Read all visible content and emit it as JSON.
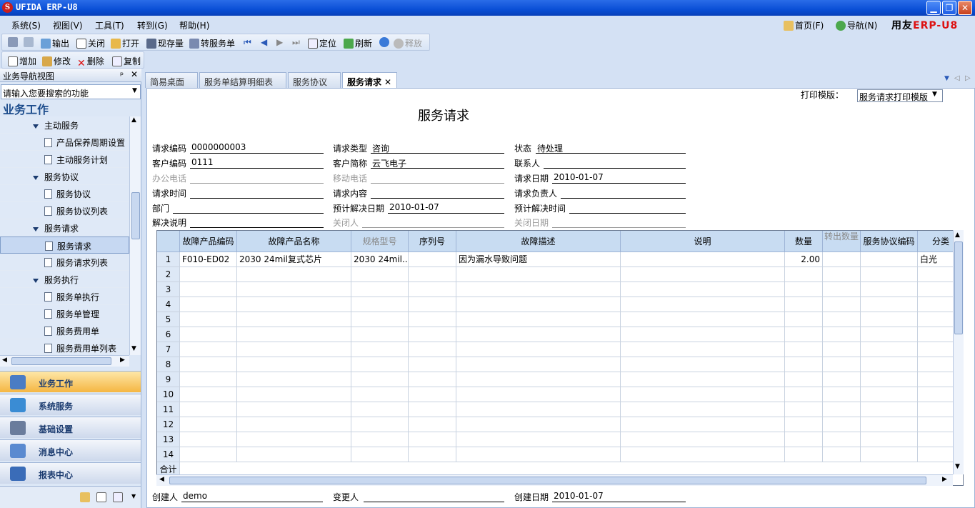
{
  "window": {
    "title": "UFIDA ERP-U8",
    "icon_letter": "S"
  },
  "menu": [
    {
      "label": "系统(S)"
    },
    {
      "label": "视图(V)"
    },
    {
      "label": "工具(T)"
    },
    {
      "label": "转到(G)"
    },
    {
      "label": "帮助(H)"
    }
  ],
  "top_links": {
    "home": "首页(F)",
    "nav": "导航(N)"
  },
  "brand": {
    "text1": "用友",
    "text2": "ERP-U8"
  },
  "toolbar1": {
    "output": "输出",
    "close": "关闭",
    "open": "打开",
    "stock": "现存量",
    "transfer": "转服务单",
    "locate": "定位",
    "refresh": "刷新",
    "release": "释放"
  },
  "toolbar2": {
    "add": "增加",
    "edit": "修改",
    "delete": "删除",
    "copy": "复制"
  },
  "nav": {
    "header": "业务导航视图",
    "search_placeholder": "请输入您要搜索的功能",
    "section": "业务工作",
    "tree": [
      {
        "label": "主动服务",
        "type": "group"
      },
      {
        "label": "产品保养周期设置",
        "type": "item"
      },
      {
        "label": "主动服务计划",
        "type": "item"
      },
      {
        "label": "服务协议",
        "type": "group"
      },
      {
        "label": "服务协议",
        "type": "item"
      },
      {
        "label": "服务协议列表",
        "type": "item"
      },
      {
        "label": "服务请求",
        "type": "group"
      },
      {
        "label": "服务请求",
        "type": "item",
        "selected": true
      },
      {
        "label": "服务请求列表",
        "type": "item"
      },
      {
        "label": "服务执行",
        "type": "group"
      },
      {
        "label": "服务单执行",
        "type": "item"
      },
      {
        "label": "服务单管理",
        "type": "item"
      },
      {
        "label": "服务费用单",
        "type": "item"
      },
      {
        "label": "服务费用单列表",
        "type": "item"
      }
    ],
    "big_buttons": [
      {
        "label": "业务工作",
        "active": true,
        "color": "#4a7cc4"
      },
      {
        "label": "系统服务",
        "color": "#3a8cd4"
      },
      {
        "label": "基础设置",
        "color": "#6a7c9c"
      },
      {
        "label": "消息中心",
        "color": "#5a8ad0"
      },
      {
        "label": "报表中心",
        "color": "#3a6cb8"
      }
    ]
  },
  "tabs": [
    {
      "label": "简易桌面"
    },
    {
      "label": "服务单结算明细表"
    },
    {
      "label": "服务协议"
    },
    {
      "label": "服务请求",
      "active": true
    }
  ],
  "form": {
    "print_label": "打印模版：",
    "print_template": "服务请求打印模版",
    "title": "服务请求",
    "fields": {
      "req_code_label": "请求编码",
      "req_code": "0000000003",
      "req_type_label": "请求类型",
      "req_type": "咨询",
      "status_label": "状态",
      "status": "待处理",
      "cust_code_label": "客户编码",
      "cust_code": "0111",
      "cust_name_label": "客户简称",
      "cust_name": "云飞电子",
      "contact_label": "联系人",
      "office_phone_label": "办公电话",
      "mobile_label": "移动电话",
      "req_date_label": "请求日期",
      "req_date": "2010-01-07",
      "req_time_label": "请求时间",
      "req_content_label": "请求内容",
      "req_owner_label": "请求负责人",
      "dept_label": "部门",
      "plan_date_label": "预计解决日期",
      "plan_date": "2010-01-07",
      "plan_time_label": "预计解决时间",
      "solution_label": "解决说明",
      "closer_label": "关闭人",
      "close_date_label": "关闭日期"
    },
    "footer": {
      "creator_label": "创建人",
      "creator": "demo",
      "modifier_label": "变更人",
      "created_date_label": "创建日期",
      "created_date": "2010-01-07"
    }
  },
  "grid": {
    "headers": [
      "故障产品编码",
      "故障产品名称",
      "规格型号",
      "序列号",
      "故障描述",
      "说明",
      "数量",
      "转出数量",
      "服务协议编码",
      "分类"
    ],
    "rows": [
      {
        "no": "1",
        "code": "F010-ED02",
        "name": "2030 24mil复式芯片",
        "spec": "2030 24mil...",
        "serial": "",
        "desc": "因为漏水导致问题",
        "note": "",
        "qty": "2.00",
        "out": "",
        "agree": "",
        "cat": "白光"
      }
    ],
    "row_numbers": [
      "1",
      "2",
      "3",
      "4",
      "5",
      "6",
      "7",
      "8",
      "9",
      "10",
      "11",
      "12",
      "13",
      "14"
    ],
    "total_label": "合计"
  }
}
